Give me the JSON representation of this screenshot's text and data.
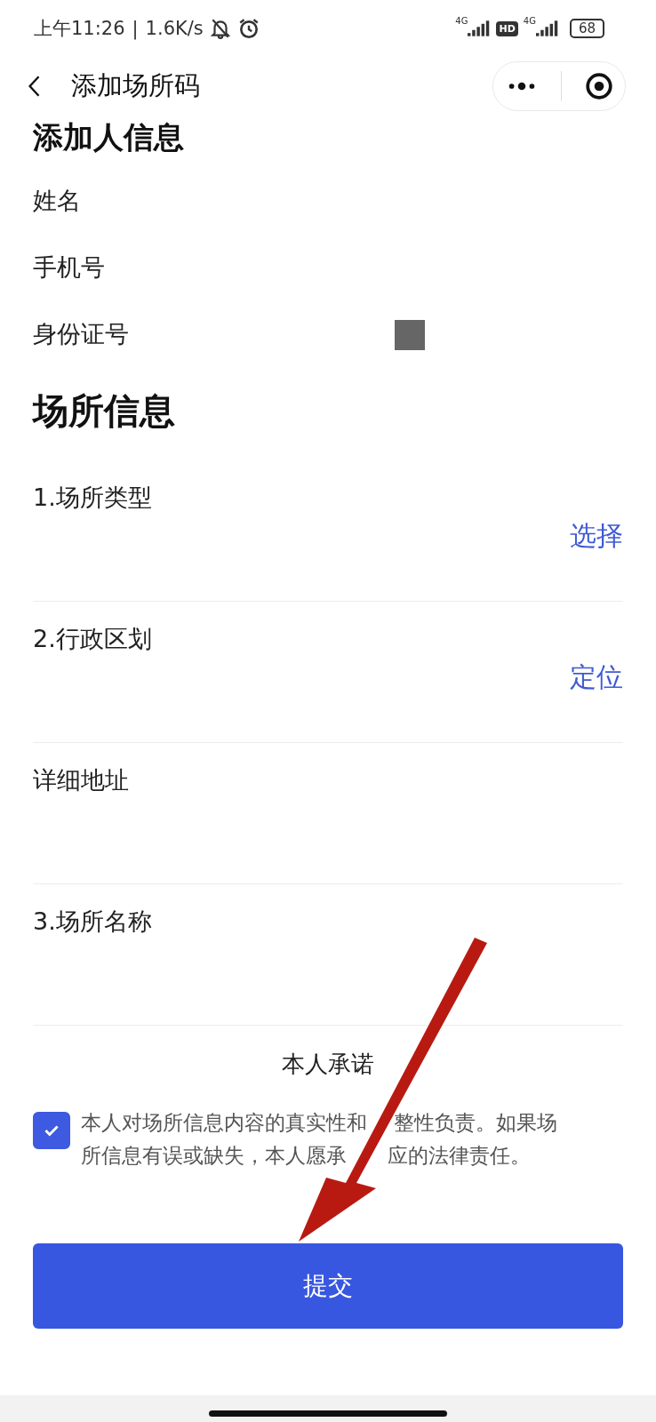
{
  "status_bar": {
    "time": "上午11:26",
    "divider": "|",
    "speed": "1.6K/s",
    "battery": "68",
    "net_1": "4G",
    "net_2": "4G",
    "hd": "HD"
  },
  "header": {
    "title": "添加场所码"
  },
  "person_section": {
    "title": "添加人信息",
    "fields": [
      {
        "label": "姓名"
      },
      {
        "label": "手机号"
      },
      {
        "label": "身份证号",
        "redacted": true
      }
    ]
  },
  "place_section": {
    "title": "场所信息",
    "fields": [
      {
        "label": "1.场所类型",
        "action": "选择"
      },
      {
        "label": "2.行政区划",
        "action": "定位"
      },
      {
        "label": "详细地址"
      },
      {
        "label": "3.场所名称"
      }
    ]
  },
  "pledge": {
    "title": "本人承诺",
    "checked": true,
    "lines": [
      [
        "本人对场所信息内容的真实性和",
        "整性负责。如果场"
      ],
      [
        "所信息有误或缺失，本人愿承",
        "应的法律责任。"
      ]
    ]
  },
  "submit_button": "提交",
  "annotation": {
    "kind": "arrow"
  }
}
